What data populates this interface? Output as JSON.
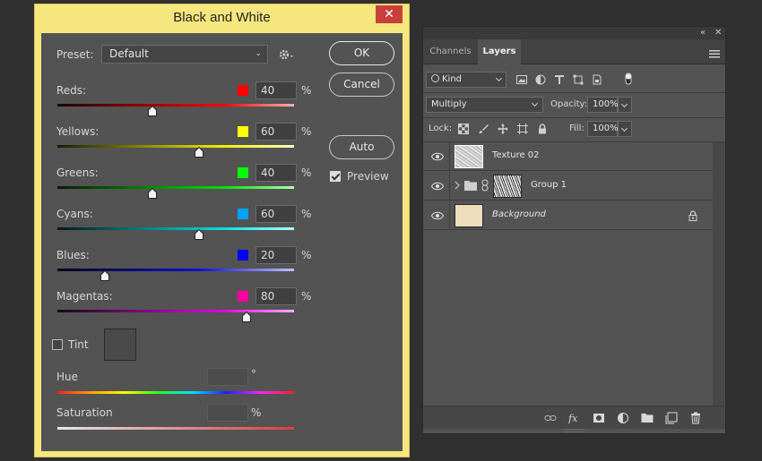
{
  "dialog": {
    "title": "Black and White",
    "close_symbol": "✕",
    "preset_label": "Preset:",
    "preset_value": "Default",
    "ok_label": "OK",
    "cancel_label": "Cancel",
    "auto_label": "Auto",
    "preview_label": "Preview",
    "preview_checked": true,
    "percent_symbol": "%",
    "channels": [
      {
        "label": "Reds:",
        "value": "40",
        "swatch": "#ff0000",
        "gradient": "linear-gradient(to right,#1a0505,#ff0000 70%,#ffb0b0)",
        "level": 40
      },
      {
        "label": "Yellows:",
        "value": "60",
        "swatch": "#ffff00",
        "gradient": "linear-gradient(to right,#1a1a05,#f0f000 70%,#fffcc0)",
        "level": 60
      },
      {
        "label": "Greens:",
        "value": "40",
        "swatch": "#00ff00",
        "gradient": "linear-gradient(to right,#051a05,#00e000 70%,#b0ffb0)",
        "level": 40
      },
      {
        "label": "Cyans:",
        "value": "60",
        "swatch": "#00a2ff",
        "gradient": "linear-gradient(to right,#05171a,#00e0e0 70%,#b0ffff)",
        "level": 60
      },
      {
        "label": "Blues:",
        "value": "20",
        "swatch": "#0000ff",
        "gradient": "linear-gradient(to right,#05051a,#1010d0 60%,#c0c0ff)",
        "level": 20
      },
      {
        "label": "Magentas:",
        "value": "80",
        "swatch": "#ff00a0",
        "gradient": "linear-gradient(to right,#1a051a,#e000e0 70%,#ffb0ff)",
        "level": 80
      }
    ],
    "tint_label": "Tint",
    "tint_checked": false,
    "hue_label": "Hue",
    "hue_value": "",
    "hue_unit": "°",
    "saturation_label": "Saturation",
    "saturation_value": "",
    "saturation_unit": "%",
    "preset_chevron": "⌄",
    "gear_icon": "gear-icon"
  },
  "panel": {
    "tabs": [
      {
        "label": "Channels",
        "active": false
      },
      {
        "label": "Layers",
        "active": true
      }
    ],
    "collapse_symbol": "«",
    "close_symbol": "✕",
    "filter_label": "Kind",
    "blend_mode": "Multiply",
    "opacity_label": "Opacity:",
    "opacity_value": "100%",
    "lock_label": "Lock:",
    "fill_label": "Fill:",
    "fill_value": "100%",
    "layers": [
      {
        "name": "Texture 02",
        "selected": true,
        "italic": false,
        "type": "texture"
      },
      {
        "name": "Group 1",
        "selected": false,
        "italic": false,
        "type": "group"
      },
      {
        "name": "Background",
        "selected": false,
        "italic": true,
        "type": "background",
        "fill": "#eedcbc"
      }
    ],
    "colors": {
      "selected_row": "#696969",
      "background_thumb": "#eedcbc"
    }
  }
}
